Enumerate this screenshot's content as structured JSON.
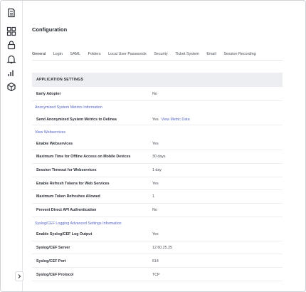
{
  "sidebar": {
    "icons": [
      "document-stack-icon",
      "grid-icon",
      "lock-icon",
      "bell-icon",
      "bar-chart-icon",
      "cube-icon"
    ],
    "expand_icon": "chevron-right-icon"
  },
  "page": {
    "title": "Configuration"
  },
  "tabs": [
    {
      "label": "General",
      "active": true
    },
    {
      "label": "Login"
    },
    {
      "label": "SAML"
    },
    {
      "label": "Folders"
    },
    {
      "label": "Local User Passwords"
    },
    {
      "label": "Security"
    },
    {
      "label": "Ticket System"
    },
    {
      "label": "Email"
    },
    {
      "label": "Session Recording"
    }
  ],
  "section": {
    "title": "APPLICATION SETTINGS"
  },
  "rows": {
    "early_adopter": {
      "label": "Early Adopter",
      "value": "No"
    },
    "send_metrics": {
      "label": "Send Anonymized System Metrics to Delinea",
      "value": "Yes",
      "link": "View Metric Data"
    },
    "enable_webservices": {
      "label": "Enable Webservices",
      "value": "Yes"
    },
    "max_offline": {
      "label": "Maximum Time for Offline Access on Mobile Devices",
      "value": "30 days"
    },
    "session_timeout": {
      "label": "Session Timeout for Webservices",
      "value": "1 day"
    },
    "refresh_tokens": {
      "label": "Enable Refresh Tokens for Web Services",
      "value": "Yes"
    },
    "max_refreshes": {
      "label": "Maximum Token Refreshes Allowed",
      "value": "1"
    },
    "prevent_api": {
      "label": "Prevent Direct API Authentication",
      "value": "No"
    },
    "syslog_output": {
      "label": "Enable Syslog/CEF Log Output",
      "value": "Yes"
    },
    "syslog_server": {
      "label": "Syslog/CEF Server",
      "value": "12.60.25.25"
    },
    "syslog_port": {
      "label": "Syslog/CEF Port",
      "value": "514"
    },
    "syslog_protocol": {
      "label": "Syslog/CEF Protocol",
      "value": "TCP"
    }
  },
  "links": {
    "anon_metrics_info": "Anonymized System Metrics Information",
    "view_webservices": "View Webservices",
    "syslog_info": "Syslog/CEF Logging Advanced Settings Information"
  },
  "colors": {
    "link": "#5566c4",
    "section_bg": "#eceef1",
    "text": "#2b2f36"
  }
}
